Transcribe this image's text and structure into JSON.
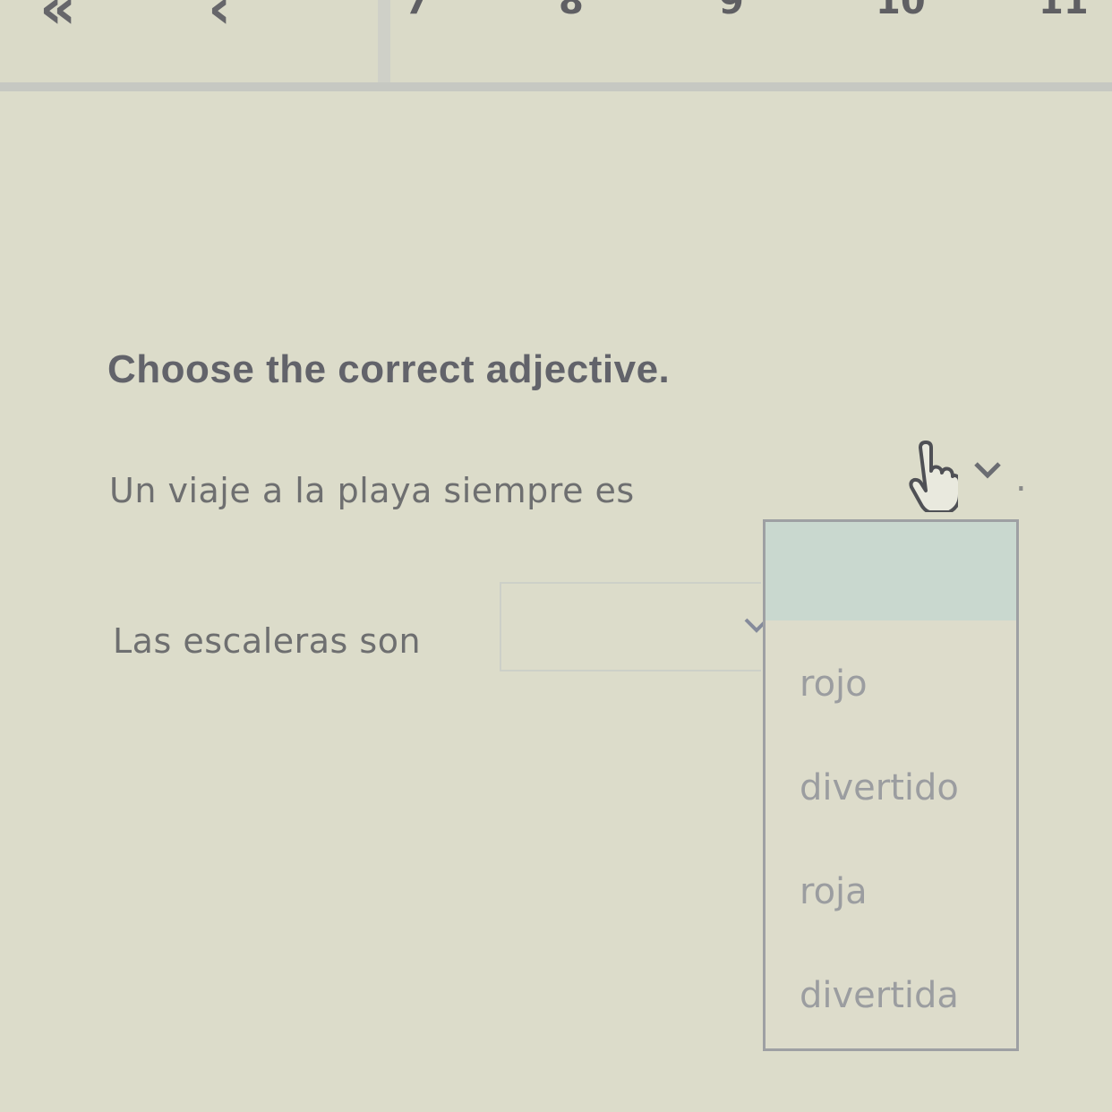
{
  "nav": {
    "first_icon": "double-chevron-left-icon",
    "prev_icon": "chevron-left-icon",
    "first_glyph": "«",
    "prev_glyph": "‹",
    "pages": [
      "7",
      "8",
      "9",
      "10",
      "11"
    ]
  },
  "question": {
    "instruction": "Choose the correct adjective.",
    "sentence1": "Un viaje a la playa siempre es",
    "sentence1_end": ".",
    "sentence2": "Las escaleras son"
  },
  "dropdown": {
    "options": [
      "rojo",
      "divertido",
      "roja",
      "divertida"
    ]
  },
  "colors": {
    "background": "#dcdcca",
    "text": "#6f6f6a",
    "option_text": "#9b9da0",
    "dropdown_border": "#9ea0a3",
    "highlight": "#c9d8cf"
  }
}
